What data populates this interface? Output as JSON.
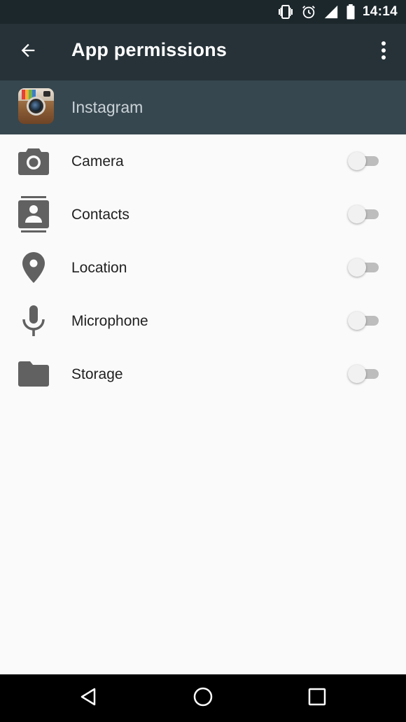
{
  "status_bar": {
    "time": "14:14",
    "icons": [
      "vibrate-icon",
      "alarm-icon",
      "signal-icon",
      "battery-icon"
    ]
  },
  "app_bar": {
    "title": "App permissions",
    "back_icon": "arrow-back-icon",
    "overflow_icon": "more-vert-icon"
  },
  "app": {
    "name": "Instagram",
    "icon": "instagram-app-icon"
  },
  "permissions": [
    {
      "label": "Camera",
      "icon": "camera-icon",
      "enabled": false
    },
    {
      "label": "Contacts",
      "icon": "contacts-icon",
      "enabled": false
    },
    {
      "label": "Location",
      "icon": "location-pin-icon",
      "enabled": false
    },
    {
      "label": "Microphone",
      "icon": "microphone-icon",
      "enabled": false
    },
    {
      "label": "Storage",
      "icon": "folder-icon",
      "enabled": false
    }
  ],
  "nav_bar": {
    "icons": [
      "back-triangle-icon",
      "home-circle-icon",
      "recents-square-icon"
    ]
  },
  "colors": {
    "status_bar_bg": "#1c272c",
    "app_bar_bg": "#263238",
    "app_header_bg": "#37474f",
    "list_bg": "#fafafa",
    "icon_gray": "#616161",
    "switch_track_off": "#bdbdbd",
    "switch_thumb_off": "#f1f1f1"
  }
}
